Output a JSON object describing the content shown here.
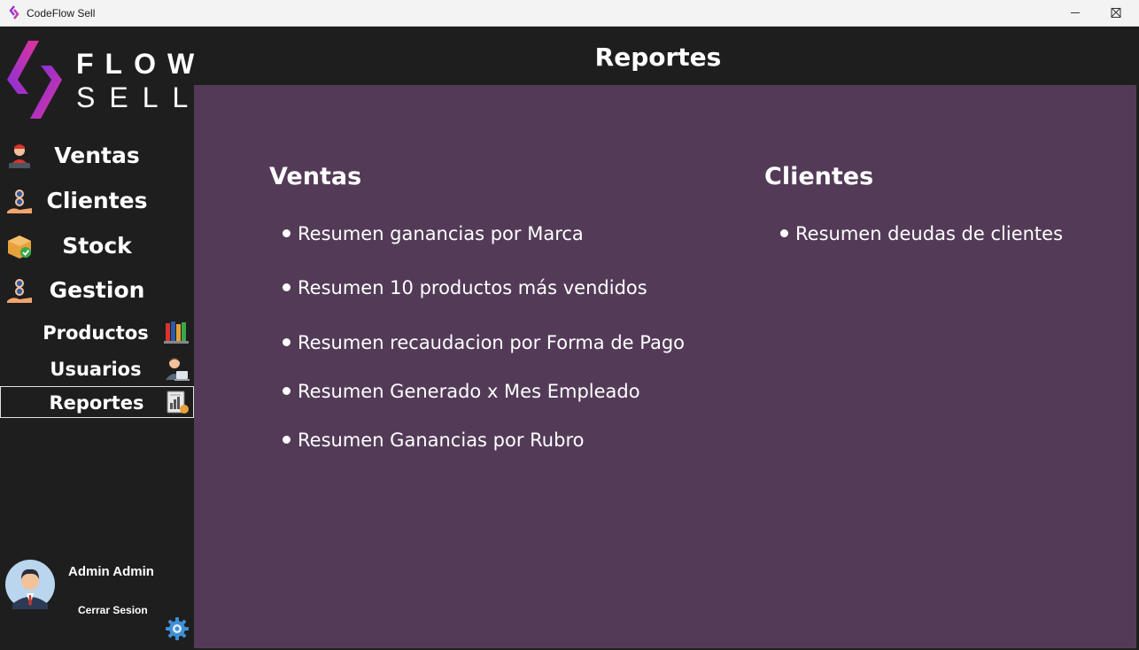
{
  "window": {
    "title": "CodeFlow Sell"
  },
  "logo": {
    "line1": "FLOW",
    "line2": "SELL"
  },
  "sidebar": {
    "items": [
      {
        "label": "Ventas",
        "icon": "seller-icon"
      },
      {
        "label": "Clientes",
        "icon": "clients-icon"
      },
      {
        "label": "Stock",
        "icon": "stock-box-icon"
      },
      {
        "label": "Gestion",
        "icon": "management-icon"
      }
    ],
    "subitems": [
      {
        "label": "Productos",
        "icon": "books-icon"
      },
      {
        "label": "Usuarios",
        "icon": "user-laptop-icon"
      },
      {
        "label": "Reportes",
        "icon": "report-icon",
        "active": true
      }
    ],
    "user": {
      "name": "Admin Admin",
      "logout_label": "Cerrar Sesion"
    }
  },
  "header": {
    "title": "Reportes"
  },
  "main": {
    "sections": [
      {
        "title": "Ventas",
        "links": [
          "Resumen ganancias por Marca",
          "Resumen 10 productos más vendidos",
          "Resumen recaudacion por Forma de Pago",
          "Resumen Generado x Mes Empleado",
          "Resumen Ganancias por Rubro"
        ]
      },
      {
        "title": "Clientes",
        "links": [
          "Resumen deudas de clientes"
        ]
      }
    ]
  },
  "colors": {
    "sidebar_bg": "#1e1e1e",
    "content_bg": "#533b58",
    "logo_gradient_start": "#e0359b",
    "logo_gradient_end": "#7b2fe0"
  }
}
